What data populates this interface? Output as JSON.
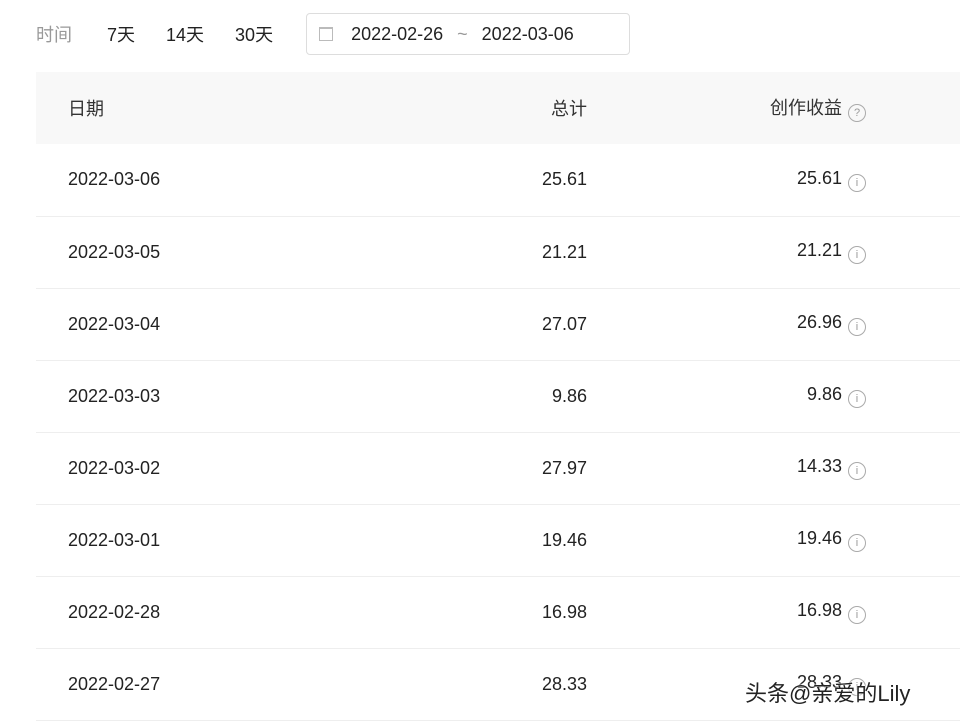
{
  "filter": {
    "label": "时间",
    "options": [
      "7天",
      "14天",
      "30天"
    ],
    "start": "2022-02-26",
    "separator": "~",
    "end": "2022-03-06"
  },
  "table": {
    "headers": [
      "日期",
      "总计",
      "创作收益"
    ],
    "rows": [
      [
        "2022-03-06",
        "25.61",
        "25.61"
      ],
      [
        "2022-03-05",
        "21.21",
        "21.21"
      ],
      [
        "2022-03-04",
        "27.07",
        "26.96"
      ],
      [
        "2022-03-03",
        "9.86",
        "9.86"
      ],
      [
        "2022-03-02",
        "27.97",
        "14.33"
      ],
      [
        "2022-03-01",
        "19.46",
        "19.46"
      ],
      [
        "2022-02-28",
        "16.98",
        "16.98"
      ],
      [
        "2022-02-27",
        "28.33",
        "28.33"
      ]
    ]
  },
  "watermark": "头条@亲爱的Lily"
}
